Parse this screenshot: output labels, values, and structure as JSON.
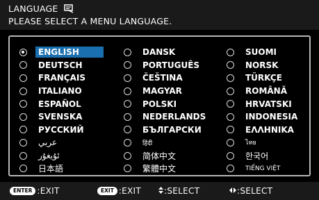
{
  "header": {
    "title": "LANGUAGE",
    "title_icon": "menu-language-icon",
    "subtitle": "PLEASE SELECT A MENU LANGUAGE."
  },
  "languages": {
    "col1": [
      "ENGLISH",
      "DEUTSCH",
      "FRANÇAIS",
      "ITALIANO",
      "ESPAÑOL",
      "SVENSKA",
      "РУССКИЙ",
      "عربي",
      "ئۇيغۇر",
      "日本語"
    ],
    "col2": [
      "DANSK",
      "PORTUGUÊS",
      "ČEŠTINA",
      "MAGYAR",
      "POLSKI",
      "NEDERLANDS",
      "БЪЛГАРСКИ",
      "हिंदी",
      "简体中文",
      "繁體中文"
    ],
    "col3": [
      "SUOMI",
      "NORSK",
      "TÜRKÇE",
      "ROMÂNĂ",
      "HRVATSKI",
      "INDONESIA",
      "ΕΛΛΗΝΙΚΑ",
      "ไทย",
      "한국어",
      "TIẾNG VIỆT"
    ],
    "selected": "ENGLISH"
  },
  "footer": {
    "enter_key": "ENTER",
    "enter_label": ":EXIT",
    "exit_key": "EXIT",
    "exit_label": ":EXIT",
    "updown_icon": "up-down-arrow-icon",
    "updown_label": ":SELECT",
    "leftright_icon": "left-right-arrow-icon",
    "leftright_label": ":SELECT"
  },
  "colors": {
    "highlight": "#1a6fb0",
    "bar_bg": "#1a1a1a",
    "border": "#b8b8b8"
  }
}
